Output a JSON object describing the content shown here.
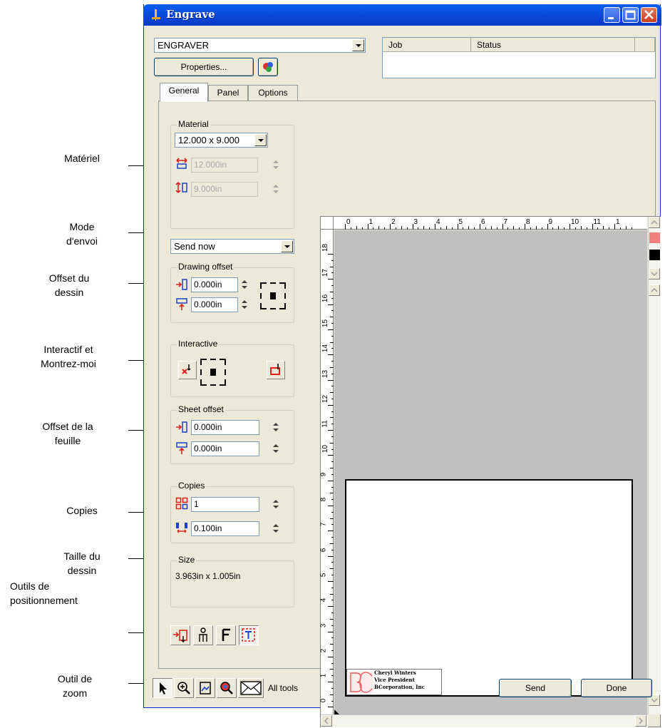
{
  "annotations": [
    {
      "id": "materiel",
      "text": "Matériel"
    },
    {
      "id": "mode",
      "text": "Mode\nd'envoi"
    },
    {
      "id": "offset-dessin",
      "text": "Offset du\ndessin"
    },
    {
      "id": "interactif",
      "text": "Interactif et\nMontrez-moi"
    },
    {
      "id": "offset-feuille",
      "text": "Offset de la\nfeuille"
    },
    {
      "id": "copies",
      "text": "Copies"
    },
    {
      "id": "taille",
      "text": "Taille du\ndessin"
    },
    {
      "id": "outils",
      "text": "Outils de\npositionnement"
    },
    {
      "id": "zoom",
      "text": "Outil de\nzoom"
    }
  ],
  "window": {
    "title": "Engrave"
  },
  "printer": {
    "selected": "ENGRAVER",
    "properties_label": "Properties..."
  },
  "job_table": {
    "columns": [
      "Job",
      "Status"
    ]
  },
  "tabs": [
    "General",
    "Panel",
    "Options"
  ],
  "material": {
    "label": "Material",
    "size_selected": "12.000 x 9.000",
    "width": "12.000in",
    "height": "9.000in"
  },
  "send_mode": {
    "selected": "Send now"
  },
  "drawing_offset": {
    "label": "Drawing offset",
    "x": "0.000in",
    "y": "0.000in"
  },
  "interactive": {
    "label": "Interactive"
  },
  "sheet_offset": {
    "label": "Sheet offset",
    "x": "0.000in",
    "y": "0.000in"
  },
  "copies": {
    "label": "Copies",
    "count": "1",
    "spacing": "0.100in"
  },
  "size": {
    "label": "Size",
    "value": "3.963in x 1.005in"
  },
  "ruler": {
    "top": [
      "0",
      "1",
      "2",
      "3",
      "4",
      "5",
      "6",
      "7",
      "8",
      "9",
      "10",
      "11",
      "1"
    ],
    "left": [
      "18",
      "17",
      "16",
      "15",
      "14",
      "13",
      "12",
      "11",
      "10",
      "9",
      "8",
      "7",
      "6",
      "5",
      "4",
      "3",
      "2",
      "1",
      "0"
    ]
  },
  "artwork": {
    "line1": "Cheryl Winters",
    "line2": "Vice President",
    "line3": "BCorporation, Inc"
  },
  "bottom_toolbar": {
    "all_tools_label": "All tools",
    "send_label": "Send",
    "done_label": "Done"
  },
  "colors": {
    "swatch_red": "#f08080",
    "swatch_black": "#000000"
  }
}
